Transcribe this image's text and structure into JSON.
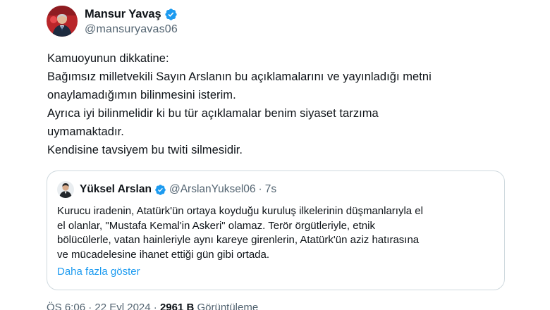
{
  "tweet": {
    "author": {
      "name": "Mansur Yavaş",
      "handle": "@mansuryavas06"
    },
    "text_lines": [
      "Kamuoyunun dikkatine:",
      "Bağımsız milletvekili Sayın Arslanın bu açıklamalarını ve yayınladığı metni",
      "onaylamadığımın bilinmesini isterim.",
      "Ayrıca iyi bilinmelidir ki bu tür açıklamalar benim siyaset tarzıma",
      "uymamaktadır.",
      "Kendisine tavsiyem bu twiti silmesidir."
    ],
    "quote": {
      "author": {
        "name": "Yüksel Arslan",
        "handle": "@ArslanYuksel06",
        "separator": "·",
        "time": "7s"
      },
      "text_lines": [
        "Kurucu iradenin, Atatürk'ün ortaya koyduğu kuruluş ilkelerinin düşmanlarıyla el",
        "el olanlar, \"Mustafa Kemal'in Askeri\" olamaz. Terör örgütleriyle, etnik",
        "bölücülerle, vatan hainleriyle aynı kareye girenlerin, Atatürk'ün aziz hatırasına",
        "ve mücadelesine ihanet ettiği gün gibi ortada."
      ],
      "show_more": "Daha fazla göster"
    },
    "meta": {
      "time_date": "ÖS 6:06 · 22 Eyl 2024 ·",
      "views_count": "2961 B",
      "views_label": "Görüntüleme"
    }
  },
  "colors": {
    "text": "#0f1419",
    "secondary": "#536471",
    "link": "#1d9bf0",
    "border": "#cfd9de",
    "verified": "#1d9bf0"
  },
  "icons": {
    "verified": "verified-badge-icon"
  }
}
